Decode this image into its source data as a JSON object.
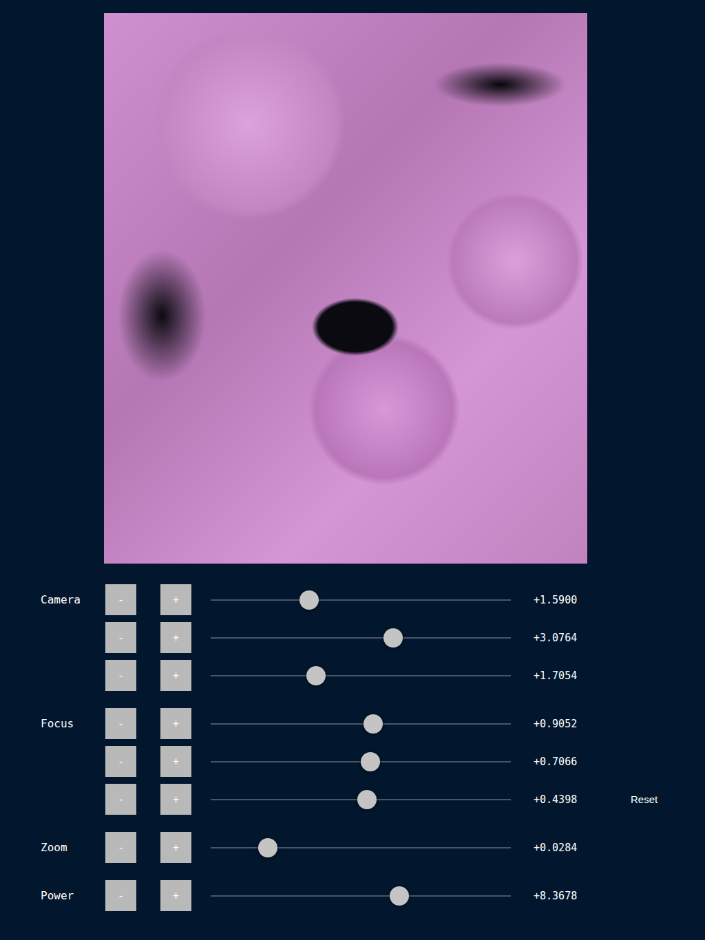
{
  "render": {
    "kind": "fractal-render"
  },
  "groups": [
    {
      "label": "Camera",
      "sliders": [
        {
          "minus": "-",
          "plus": "+",
          "level": 0.328,
          "reading": "+1.5900"
        },
        {
          "minus": "-",
          "plus": "+",
          "level": 0.608,
          "reading": "+3.0764"
        },
        {
          "minus": "-",
          "plus": "+",
          "level": 0.351,
          "reading": "+1.7054"
        }
      ]
    },
    {
      "label": "Focus",
      "sliders": [
        {
          "minus": "-",
          "plus": "+",
          "level": 0.541,
          "reading": "+0.9052"
        },
        {
          "minus": "-",
          "plus": "+",
          "level": 0.532,
          "reading": "+0.7066"
        },
        {
          "minus": "-",
          "plus": "+",
          "level": 0.521,
          "reading": "+0.4398"
        }
      ]
    },
    {
      "label": "Zoom",
      "sliders": [
        {
          "minus": "-",
          "plus": "+",
          "level": 0.19,
          "reading": "+0.0284"
        }
      ]
    },
    {
      "label": "Power",
      "sliders": [
        {
          "minus": "-",
          "plus": "+",
          "level": 0.628,
          "reading": "+8.3678"
        }
      ]
    }
  ],
  "reset": {
    "label": "Reset"
  }
}
